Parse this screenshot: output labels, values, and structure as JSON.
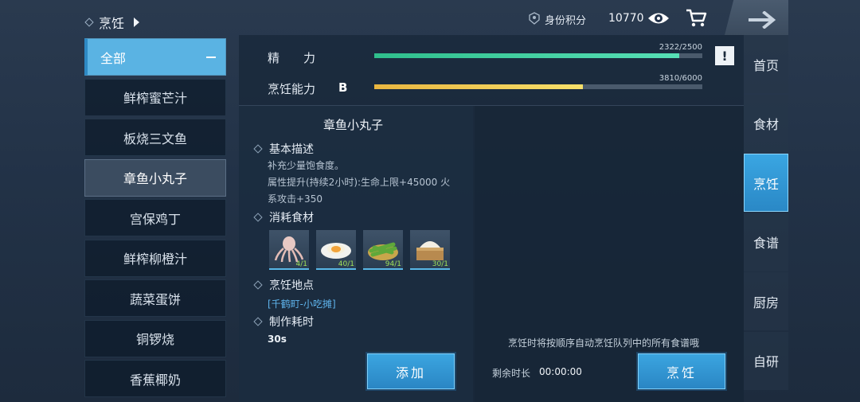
{
  "breadcrumb": {
    "label": "烹饪"
  },
  "header": {
    "score_label": "身份积分",
    "score_value": "10770"
  },
  "left_list": {
    "items": [
      "全部",
      "鲜榨蜜芒汁",
      "板烧三文鱼",
      "章鱼小丸子",
      "宫保鸡丁",
      "鲜榨柳橙汁",
      "蔬菜蛋饼",
      "铜锣烧",
      "香蕉椰奶"
    ],
    "active_index": 0,
    "selected_index": 3
  },
  "stats": {
    "energy_label": "精　　力",
    "energy_value": "2322/2500",
    "energy_fraction": 0.929,
    "cooking_label": "烹饪能力",
    "cooking_grade": "B",
    "cooking_value": "3810/6000",
    "cooking_fraction": 0.635,
    "alert_symbol": "!"
  },
  "dish": {
    "title": "章鱼小丸子",
    "basic_desc_label": "基本描述",
    "desc_line1": "补充少量饱食度。",
    "desc_line2": "属性提升(持续2小时):生命上限+45000 火系攻击+350",
    "ingredients_label": "消耗食材",
    "ingredients": [
      {
        "name": "octopus",
        "count": "4/1"
      },
      {
        "name": "egg",
        "count": "40/1"
      },
      {
        "name": "vegetable",
        "count": "94/1"
      },
      {
        "name": "flour",
        "count": "30/1"
      }
    ],
    "location_label": "烹饪地点",
    "location_value": "[千鹤町-小吃摊]",
    "time_label": "制作耗时",
    "time_value": "30s",
    "add_button": "添加"
  },
  "queue": {
    "hint": "烹饪时将按顺序自动烹饪队列中的所有食谱哦",
    "remaining_label": "剩余时长",
    "remaining_value": "00:00:00",
    "cook_button": "烹饪"
  },
  "right_nav": {
    "items": [
      "首页",
      "食材",
      "烹饪",
      "食谱",
      "厨房",
      "自研"
    ],
    "active_index": 2
  },
  "colors": {
    "accent": "#3ba5e0",
    "energy": "#3fcf9a",
    "cooking": "#f2cf55"
  }
}
